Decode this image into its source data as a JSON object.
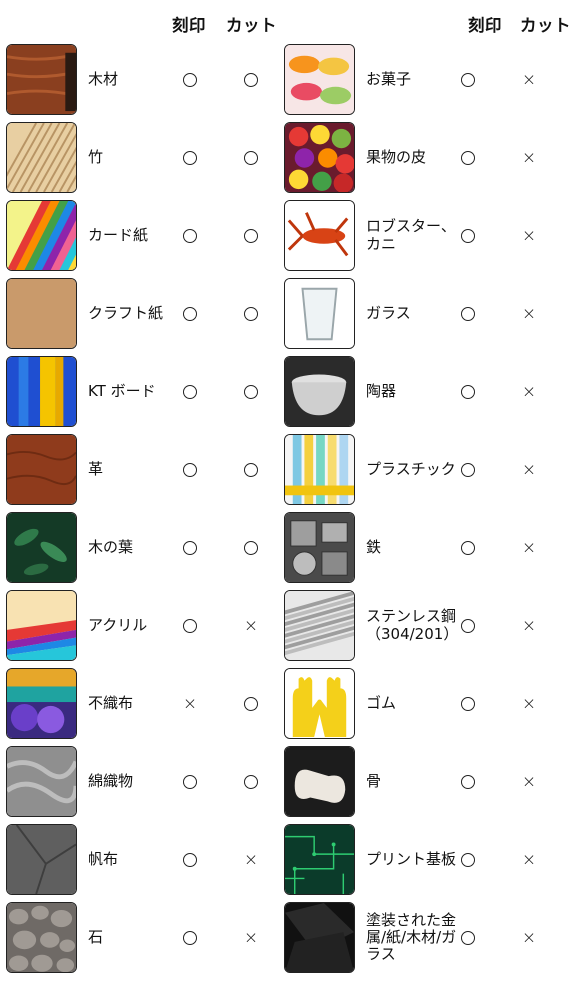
{
  "headers": {
    "engrave": "刻印",
    "cut": "カット"
  },
  "left_items": [
    {
      "name": "木材",
      "engrave": "○",
      "cut": "○",
      "icon": "wood-icon"
    },
    {
      "name": "竹",
      "engrave": "○",
      "cut": "○",
      "icon": "bamboo-icon"
    },
    {
      "name": "カード紙",
      "engrave": "○",
      "cut": "○",
      "icon": "cardstock-icon"
    },
    {
      "name": "クラフト紙",
      "engrave": "○",
      "cut": "○",
      "icon": "kraft-paper-icon"
    },
    {
      "name": "KT ボード",
      "engrave": "○",
      "cut": "○",
      "icon": "kt-board-icon"
    },
    {
      "name": "革",
      "engrave": "○",
      "cut": "○",
      "icon": "leather-icon"
    },
    {
      "name": "木の葉",
      "engrave": "○",
      "cut": "○",
      "icon": "leaf-icon"
    },
    {
      "name": "アクリル",
      "engrave": "○",
      "cut": "×",
      "icon": "acrylic-icon"
    },
    {
      "name": "不織布",
      "engrave": "×",
      "cut": "○",
      "icon": "nonwoven-icon"
    },
    {
      "name": "綿織物",
      "engrave": "○",
      "cut": "○",
      "icon": "cotton-icon"
    },
    {
      "name": "帆布",
      "engrave": "○",
      "cut": "×",
      "icon": "canvas-icon"
    },
    {
      "name": "石",
      "engrave": "○",
      "cut": "×",
      "icon": "stone-icon"
    }
  ],
  "right_items": [
    {
      "name": "お菓子",
      "engrave": "○",
      "cut": "×",
      "icon": "macaron-icon"
    },
    {
      "name": "果物の皮",
      "engrave": "○",
      "cut": "×",
      "icon": "fruit-icon"
    },
    {
      "name": "ロブスター、カニ",
      "engrave": "○",
      "cut": "×",
      "icon": "lobster-icon"
    },
    {
      "name": "ガラス",
      "engrave": "○",
      "cut": "×",
      "icon": "glass-icon"
    },
    {
      "name": "陶器",
      "engrave": "○",
      "cut": "×",
      "icon": "ceramic-icon"
    },
    {
      "name": "プラスチック",
      "engrave": "○",
      "cut": "×",
      "icon": "plastic-icon"
    },
    {
      "name": "鉄",
      "engrave": "○",
      "cut": "×",
      "icon": "iron-icon"
    },
    {
      "name": "ステンレス鋼（304/201）",
      "engrave": "○",
      "cut": "×",
      "icon": "stainless-icon"
    },
    {
      "name": "ゴム",
      "engrave": "○",
      "cut": "×",
      "icon": "rubber-glove-icon"
    },
    {
      "name": "骨",
      "engrave": "○",
      "cut": "×",
      "icon": "bone-icon"
    },
    {
      "name": "プリント基板",
      "engrave": "○",
      "cut": "×",
      "icon": "pcb-icon"
    },
    {
      "name": "塗装された金属/紙/木材/ガラス",
      "engrave": "○",
      "cut": "×",
      "icon": "painted-metal-icon"
    }
  ]
}
